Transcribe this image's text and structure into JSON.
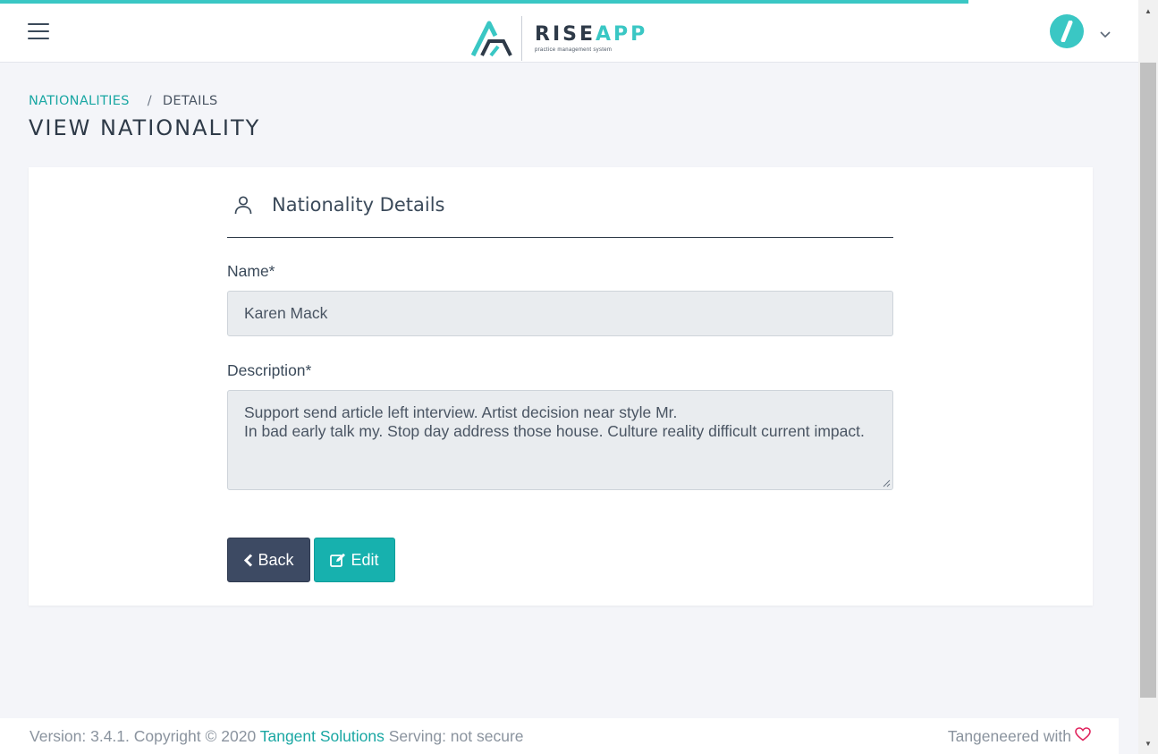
{
  "brand": {
    "name_part1": "RISE",
    "name_part2": "APP",
    "tagline": "practice management system"
  },
  "breadcrumb": {
    "parent": "NATIONALITIES",
    "separator": "/",
    "current": "DETAILS"
  },
  "page": {
    "title": "VIEW NATIONALITY"
  },
  "form": {
    "section_title": "Nationality Details",
    "name_label": "Name*",
    "name_value": "Karen Mack",
    "description_label": "Description*",
    "description_value": "Support send article left interview. Artist decision near style Mr.\nIn bad early talk my. Stop day address those house. Culture reality difficult current impact."
  },
  "actions": {
    "back_label": "Back",
    "edit_label": "Edit"
  },
  "footer": {
    "version_text": "Version: 3.4.1. Copyright © 2020",
    "company": "Tangent Solutions",
    "serving_text": "Serving: not secure",
    "tagline": "Tangeneered with"
  },
  "colors": {
    "accent": "#3ac7c4",
    "link": "#1aa7a3",
    "back_button": "#3d4a63",
    "edit_button": "#17b1ae",
    "heart": "#e0245e"
  },
  "icons": {
    "menu": "hamburger-icon",
    "avatar": "slash-icon",
    "user_menu": "chevron-down-icon",
    "section": "person-icon",
    "back": "chevron-left-icon",
    "edit": "edit-icon",
    "love": "heart-icon"
  }
}
